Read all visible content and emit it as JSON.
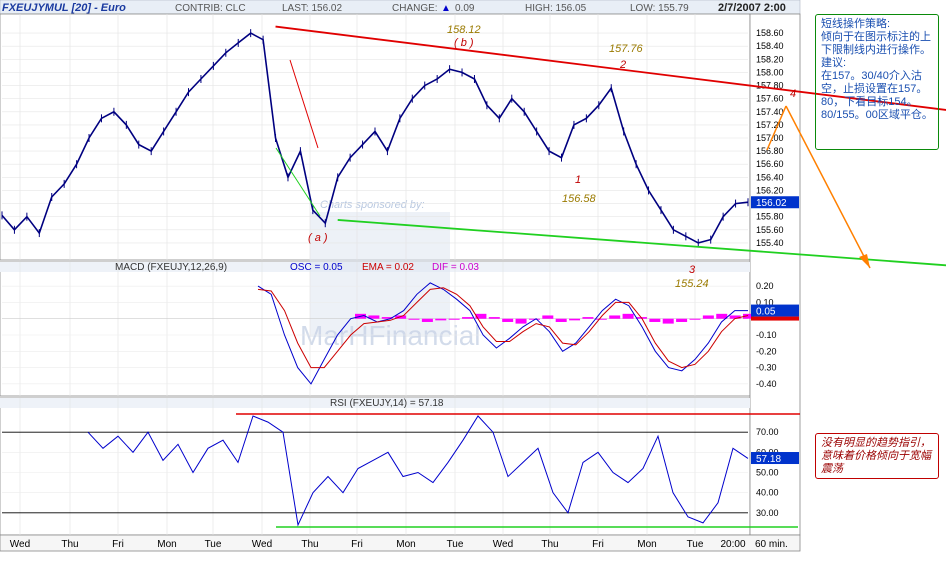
{
  "header": {
    "symbol": "FXEUJYMUL [20] - Euro",
    "contrib": "CONTRIB: CLC",
    "last": "LAST: 156.02",
    "change_label": "CHANGE:",
    "change_value": "0.09",
    "high": "HIGH: 156.05",
    "low": "LOW: 155.79",
    "datetime": "2/7/2007 2:00"
  },
  "colors": {
    "price": "#000080",
    "upper_line": "#e00000",
    "lower_line": "#20d020",
    "arrow": "#ff8000",
    "annotation_red": "#c00000",
    "annotation_gold": "#9a7a00",
    "label_box": "#0033cc",
    "histogram": "#ff00ff"
  },
  "annotations": {
    "b_value": "158.12",
    "b_label": "( b )",
    "wave2_value": "157.76",
    "wave2_label": "2",
    "wave4_label": "4",
    "wave1_label": "1",
    "wave1_value": "156.58",
    "a_label": "( a )",
    "wave3_label": "3",
    "wave3_value": "155.24",
    "sponsor": "Charts sponsored by:",
    "watermark": "MarHFinancial"
  },
  "notes": {
    "strategy": "短线操作策略:\n倾向于在图示标注的上下限制线内进行操作。\n建议:\n在157。30/40介入沽空，止损设置在157。80，下看目标154。80/155。00区域平仓。",
    "rsi_comment": "没有明显的趋势指引，意味着价格倾向于宽幅震荡"
  },
  "chart_data": [
    {
      "type": "line",
      "title": "",
      "series": [
        {
          "name": "",
          "values": [
            155.82,
            155.6,
            155.8,
            155.55,
            156.1,
            156.3,
            156.6,
            157.0,
            157.3,
            157.4,
            157.2,
            156.9,
            156.8,
            157.1,
            157.4,
            157.7,
            157.9,
            158.1,
            158.3,
            158.45,
            158.6,
            158.5,
            157.0,
            156.4,
            156.8,
            155.9,
            155.7,
            156.4,
            156.7,
            156.9,
            157.1,
            156.8,
            157.3,
            157.6,
            157.8,
            157.9,
            158.05,
            158.0,
            157.9,
            157.5,
            157.3,
            157.6,
            157.4,
            157.1,
            156.8,
            156.7,
            157.2,
            157.3,
            157.5,
            157.76,
            157.1,
            156.6,
            156.2,
            155.9,
            155.6,
            155.5,
            155.4,
            155.45,
            155.8,
            156.0,
            156.02
          ]
        }
      ],
      "ylim": [
        155.2,
        158.8
      ],
      "yticks": [
        "158.60",
        "158.40",
        "158.20",
        "158.00",
        "157.80",
        "157.60",
        "157.40",
        "157.20",
        "157.00",
        "156.80",
        "156.60",
        "156.40",
        "156.20",
        "156.00",
        "155.80",
        "155.60",
        "155.40"
      ],
      "last_label": "156.02",
      "trendlines": [
        {
          "name": "",
          "x": [
            22,
            75
          ],
          "y": [
            158.7,
            157.45
          ]
        },
        {
          "name": "",
          "x": [
            27,
            80
          ],
          "y": [
            155.75,
            155.0
          ]
        }
      ]
    },
    {
      "type": "line",
      "title": "MACD (FXEUJY,12,26,9)",
      "legend": [
        {
          "text": "OSC = 0.05",
          "color": "#0000cc"
        },
        {
          "text": "EMA = 0.02",
          "color": "#cc0000"
        },
        {
          "text": "DIF = 0.03",
          "color": "#cc00cc"
        }
      ],
      "series": [
        {
          "name": "MACD",
          "values": [
            0.2,
            0.15,
            -0.1,
            -0.3,
            -0.4,
            -0.25,
            -0.1,
            0.0,
            0.02,
            -0.02,
            0.0,
            0.05,
            0.15,
            0.22,
            0.18,
            0.12,
            0.05,
            -0.1,
            -0.18,
            -0.12,
            -0.05,
            0.0,
            -0.08,
            -0.2,
            -0.15,
            -0.05,
            0.05,
            0.12,
            0.08,
            -0.05,
            -0.2,
            -0.3,
            -0.32,
            -0.25,
            -0.15,
            -0.02,
            0.05,
            0.05
          ]
        },
        {
          "name": "Signal",
          "values": [
            0.18,
            0.17,
            0.05,
            -0.15,
            -0.3,
            -0.3,
            -0.2,
            -0.1,
            -0.03,
            -0.02,
            -0.01,
            0.02,
            0.1,
            0.18,
            0.19,
            0.15,
            0.08,
            -0.05,
            -0.14,
            -0.14,
            -0.08,
            -0.03,
            -0.05,
            -0.15,
            -0.16,
            -0.08,
            0.02,
            0.1,
            0.1,
            0.0,
            -0.15,
            -0.26,
            -0.3,
            -0.28,
            -0.2,
            -0.08,
            0.0,
            0.02
          ]
        }
      ],
      "histogram": [
        0.03,
        0.02,
        0.01,
        0.02,
        0.0,
        -0.02,
        -0.01,
        0.0,
        0.01,
        0.03,
        0.01,
        -0.02,
        -0.03,
        0.0,
        0.02,
        -0.02,
        -0.01,
        0.01,
        0.0,
        0.02,
        0.03,
        0.01,
        -0.02,
        -0.03,
        -0.02,
        0.0,
        0.02,
        0.03,
        0.02,
        0.03
      ],
      "ylim": [
        -0.45,
        0.25
      ],
      "yticks": [
        "0.20",
        "0.10",
        "-0.10",
        "-0.20",
        "-0.30",
        "-0.40"
      ],
      "last_label": "0.05"
    },
    {
      "type": "line",
      "title": "RSI (FXEUJY,14) = 57.18",
      "series": [
        {
          "name": "RSI",
          "values": [
            70,
            62,
            68,
            60,
            70,
            56,
            64,
            50,
            62,
            66,
            55,
            78,
            75,
            70,
            24,
            40,
            48,
            40,
            52,
            56,
            60,
            48,
            50,
            45,
            55,
            66,
            78,
            70,
            48,
            55,
            62,
            40,
            30,
            55,
            60,
            50,
            45,
            52,
            68,
            40,
            28,
            25,
            35,
            62,
            57
          ]
        }
      ],
      "ylim": [
        20,
        80
      ],
      "yticks": [
        "70.00",
        "60.00",
        "50.00",
        "40.00",
        "30.00"
      ],
      "overbought": 70,
      "oversold": 30,
      "last_label": "57.18"
    }
  ],
  "xaxis": {
    "labels": [
      "Wed",
      "Thu",
      "Fri",
      "Mon",
      "Tue",
      "Wed",
      "Thu",
      "Fri",
      "Mon",
      "Tue",
      "Wed",
      "Thu",
      "Fri",
      "Mon",
      "Tue",
      "20:00"
    ],
    "interval": "60 min."
  }
}
